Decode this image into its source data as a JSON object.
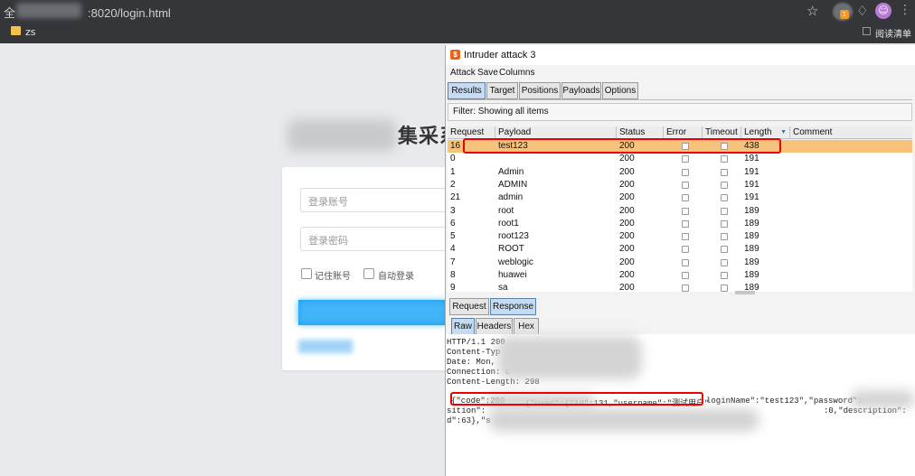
{
  "browser": {
    "url_prefix": "全",
    "url_suffix": ":8020/login.html",
    "bookmark": "zs",
    "reader_mode": "阅读清单",
    "ext_badge": "1",
    "avatar_glyph": "☺"
  },
  "login": {
    "title_partial": "集采系",
    "username_placeholder": "登录账号",
    "password_placeholder": "登录密码",
    "remember_label": "记住账号",
    "autologin_label": "自动登录"
  },
  "burp": {
    "title": "Intruder attack 3",
    "menu": [
      "Attack",
      "Save",
      "Columns"
    ],
    "tabs": [
      "Results",
      "Target",
      "Positions",
      "Payloads",
      "Options"
    ],
    "filter": "Filter: Showing all items",
    "columns": [
      "Request",
      "Payload",
      "Status",
      "Error",
      "Timeout",
      "Length",
      "Comment"
    ],
    "rows": [
      {
        "request": "16",
        "payload": "test123",
        "status": "200",
        "length": "438",
        "selected": true
      },
      {
        "request": "0",
        "payload": "",
        "status": "200",
        "length": "191"
      },
      {
        "request": "1",
        "payload": "Admin",
        "status": "200",
        "length": "191"
      },
      {
        "request": "2",
        "payload": "ADMIN",
        "status": "200",
        "length": "191"
      },
      {
        "request": "21",
        "payload": "admin",
        "status": "200",
        "length": "191"
      },
      {
        "request": "3",
        "payload": "root",
        "status": "200",
        "length": "189"
      },
      {
        "request": "6",
        "payload": "root1",
        "status": "200",
        "length": "189"
      },
      {
        "request": "5",
        "payload": "root123",
        "status": "200",
        "length": "189"
      },
      {
        "request": "4",
        "payload": "ROOT",
        "status": "200",
        "length": "189"
      },
      {
        "request": "7",
        "payload": "weblogic",
        "status": "200",
        "length": "189"
      },
      {
        "request": "8",
        "payload": "huawei",
        "status": "200",
        "length": "189"
      },
      {
        "request": "9",
        "payload": "sa",
        "status": "200",
        "length": "189"
      }
    ],
    "req_resp_tabs": [
      "Request",
      "Response"
    ],
    "view_tabs": [
      "Raw",
      "Headers",
      "Hex"
    ],
    "response_lines": [
      "HTTP/1.1 200",
      "Content-Typ",
      "Date: Mon,",
      "Connection: c",
      "Content-Length: 298",
      "",
      "{\"code\":200",
      "sition\":",
      "d\":63},\"s"
    ],
    "response_body_fragments": [
      "{\"user\":{\"id\":131,\"username\":\"测试用户\"",
      "loginName\":\"test123\",\"password\":",
      ":0,\"description\":"
    ]
  },
  "colors": {
    "chrome_bg": "#35363a",
    "page_bg": "#e8eaed",
    "login_button": "#17a0f4",
    "selected_row": "#f7c279",
    "annotation_red": "#e00000"
  }
}
